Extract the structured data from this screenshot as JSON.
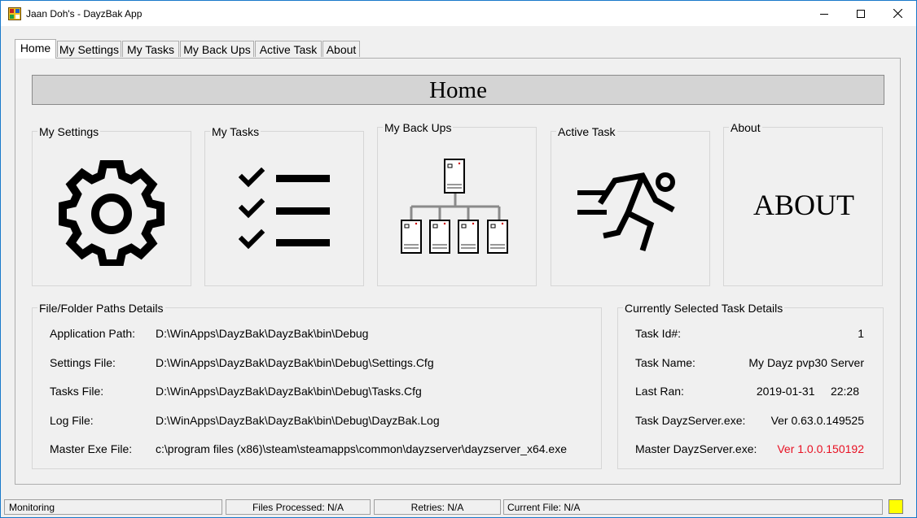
{
  "window": {
    "title": "Jaan Doh's - DayzBak App",
    "minimize_icon": "minimize-icon",
    "maximize_icon": "maximize-icon",
    "close_icon": "close-icon"
  },
  "tabs": [
    {
      "label": "Home",
      "active": true
    },
    {
      "label": "My Settings",
      "active": false
    },
    {
      "label": "My Tasks",
      "active": false
    },
    {
      "label": "My Back Ups",
      "active": false
    },
    {
      "label": "Active Task",
      "active": false
    },
    {
      "label": "About",
      "active": false
    }
  ],
  "home": {
    "banner": "Home",
    "tiles": [
      {
        "label": "My Settings",
        "icon": "gear-icon"
      },
      {
        "label": "My Tasks",
        "icon": "checklist-icon"
      },
      {
        "label": "My Back Ups",
        "icon": "server-network-icon"
      },
      {
        "label": "Active Task",
        "icon": "running-man-icon"
      },
      {
        "label": "About",
        "icon": "about-text",
        "text": "ABOUT"
      }
    ]
  },
  "paths": {
    "title": "File/Folder Paths Details",
    "rows": [
      {
        "label": "Application Path:",
        "value": "D:\\WinApps\\DayzBak\\DayzBak\\bin\\Debug"
      },
      {
        "label": "Settings File:",
        "value": "D:\\WinApps\\DayzBak\\DayzBak\\bin\\Debug\\Settings.Cfg"
      },
      {
        "label": "Tasks File:",
        "value": "D:\\WinApps\\DayzBak\\DayzBak\\bin\\Debug\\Tasks.Cfg"
      },
      {
        "label": "Log File:",
        "value": "D:\\WinApps\\DayzBak\\DayzBak\\bin\\Debug\\DayzBak.Log"
      },
      {
        "label": "Master Exe File:",
        "value": "c:\\program files (x86)\\steam\\steamapps\\common\\dayzserver\\dayzserver_x64.exe"
      }
    ]
  },
  "task": {
    "title": "Currently Selected Task Details",
    "rows": [
      {
        "label": "Task Id#:",
        "value": "1"
      },
      {
        "label": "Task Name:",
        "value": "My Dayz pvp30 Server"
      },
      {
        "label": "Last Ran:",
        "value": "2019-01-31     22:28"
      },
      {
        "label": "Task DayzServer.exe:",
        "value": "Ver 0.63.0.149525"
      },
      {
        "label": "Master DayzServer.exe:",
        "value": "Ver 1.0.0.150192"
      }
    ],
    "highlight_color": "#e81123"
  },
  "status": {
    "state": "Monitoring",
    "files_processed": "Files Processed: N/A",
    "retries": "Retries: N/A",
    "current_file": "Current File: N/A",
    "indicator_color": "#ffff00"
  }
}
